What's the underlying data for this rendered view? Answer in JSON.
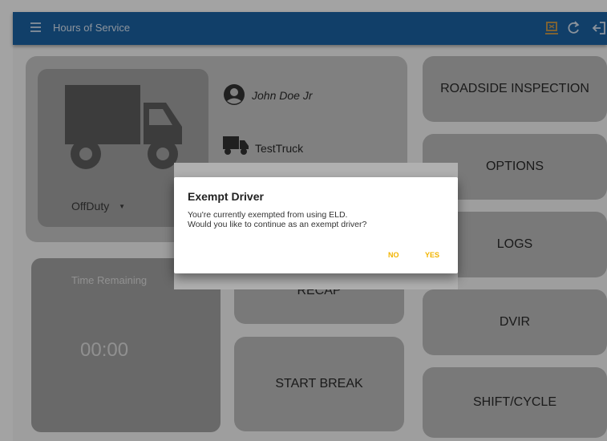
{
  "app_bar": {
    "title": "Hours of Service"
  },
  "driver": {
    "name": "John Doe Jr",
    "vehicle": "TestTruck",
    "status": "OffDuty"
  },
  "time_panel": {
    "label": "Time Remaining",
    "value": "00:00"
  },
  "center_buttons": {
    "recap": "RECAP",
    "start_break": "START BREAK"
  },
  "right_buttons": {
    "roadside": "ROADSIDE INSPECTION",
    "options": "OPTIONS",
    "logs": "LOGS",
    "dvir": "DVIR",
    "shift_cycle": "SHIFT/CYCLE"
  },
  "dialog": {
    "title": "Exempt Driver",
    "message_line1": "You're currently exempted from using ELD.",
    "message_line2": "Would you like to continue as an exempt driver?",
    "no": "NO",
    "yes": "YES"
  },
  "colors": {
    "app_bar": "#1b63a4",
    "accent": "#f2b400"
  },
  "icons": {
    "menu": "menu-icon",
    "eld": "eld-device-icon",
    "refresh": "refresh-icon",
    "logout": "logout-icon",
    "truck_large": "truck-icon",
    "account": "account-icon",
    "truck_small": "truck-small-icon"
  }
}
